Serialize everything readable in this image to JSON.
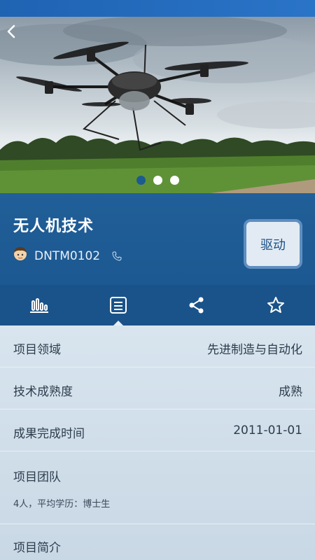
{
  "header": {
    "back_icon": "chevron-left-icon"
  },
  "carousel": {
    "slide_count": 3,
    "active_index": 0
  },
  "project": {
    "title": "无人机技术",
    "owner": "DNTM0102",
    "tag": "驱动"
  },
  "tabs": [
    {
      "icon": "bar-chart-icon"
    },
    {
      "icon": "document-list-icon",
      "selected": true
    },
    {
      "icon": "share-icon"
    },
    {
      "icon": "star-icon"
    }
  ],
  "details": {
    "field": {
      "label": "项目领域",
      "value": "先进制造与自动化"
    },
    "maturity": {
      "label": "技术成熟度",
      "value": "成熟"
    },
    "completion": {
      "label": "成果完成时间",
      "value": "2011-01-01"
    },
    "team": {
      "label": "项目团队",
      "text": "4人，平均学历：博士生"
    },
    "intro": {
      "label": "项目简介"
    }
  },
  "colors": {
    "accent": "#1a5389",
    "title_band": "#215f98",
    "tag_bg": "#e2ebf3"
  }
}
